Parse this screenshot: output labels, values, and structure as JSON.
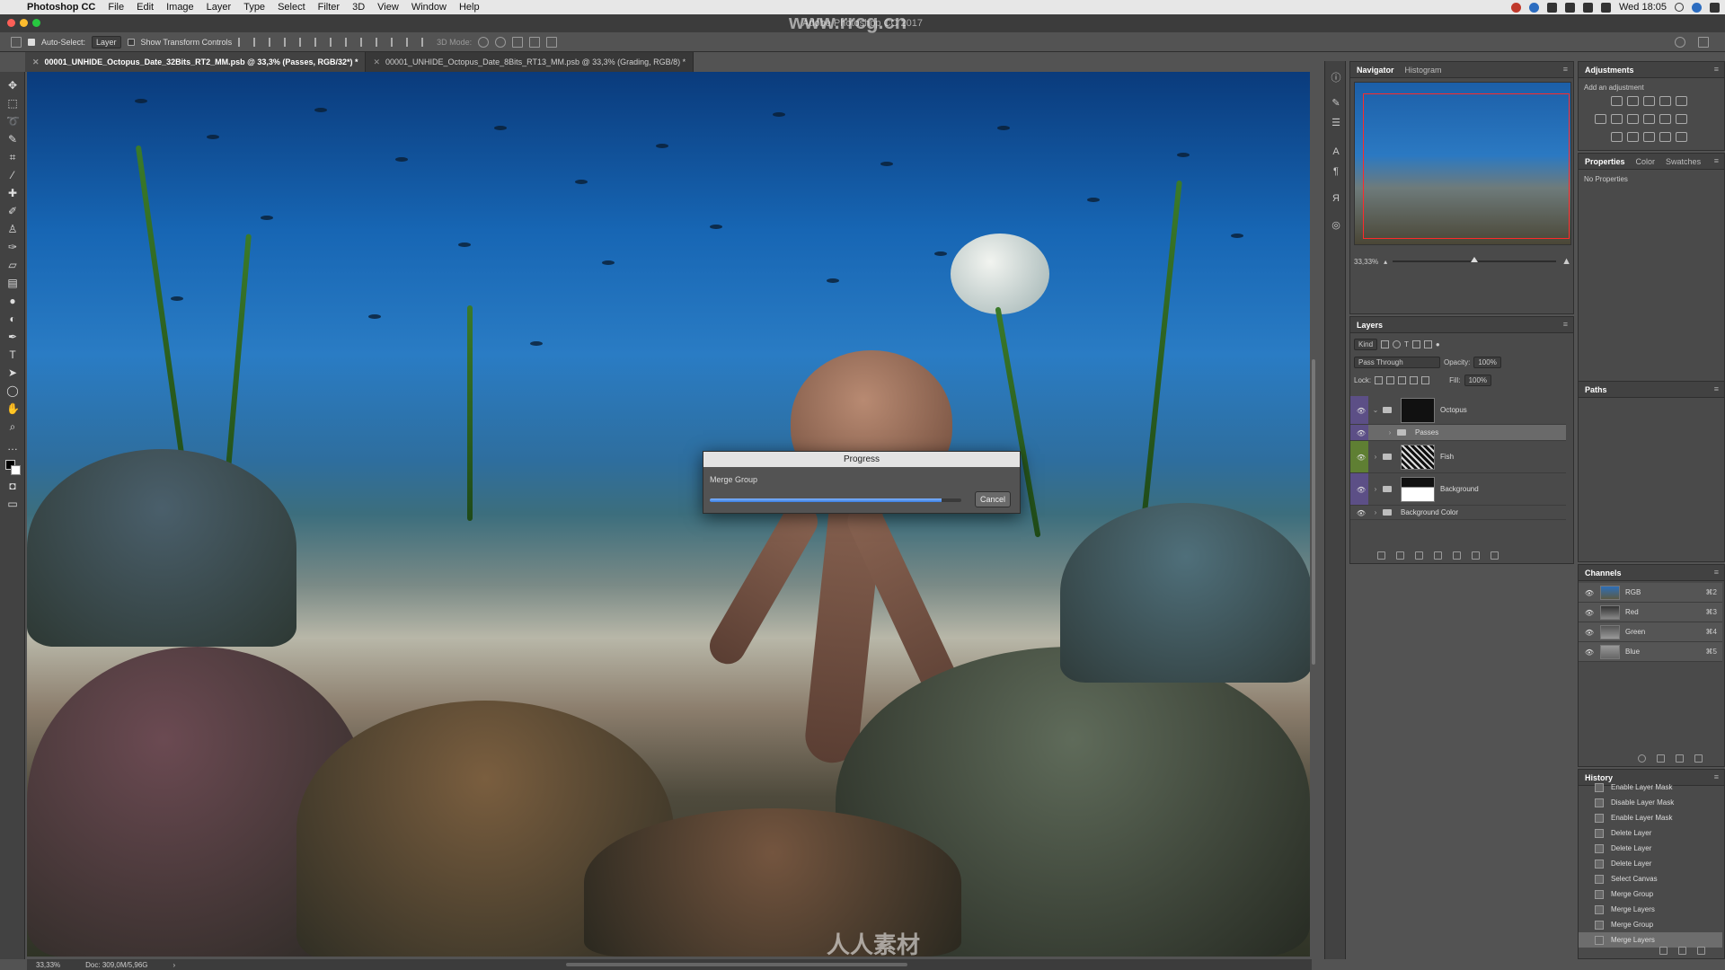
{
  "menubar": {
    "app": "Photoshop CC",
    "items": [
      "File",
      "Edit",
      "Image",
      "Layer",
      "Type",
      "Select",
      "Filter",
      "3D",
      "View",
      "Window",
      "Help"
    ],
    "clock": "Wed 18:05"
  },
  "window": {
    "title": "Adobe Photoshop CC 2017"
  },
  "options": {
    "auto_select_label": "Auto-Select:",
    "auto_select_value": "Layer",
    "transform_label": "Show Transform Controls",
    "mode_3d": "3D Mode:"
  },
  "tabs": [
    {
      "label": "00001_UNHIDE_Octopus_Date_32Bits_RT2_MM.psb @ 33,3% (Passes, RGB/32*) *"
    },
    {
      "label": "00001_UNHIDE_Octopus_Date_8Bits_RT13_MM.psb @ 33,3% (Grading, RGB/8) *"
    }
  ],
  "progress": {
    "title": "Progress",
    "label": "Merge Group",
    "value": 0.92,
    "cancel": "Cancel"
  },
  "statusbar": {
    "zoom": "33,33%",
    "doc": "Doc: 309,0M/5,96G"
  },
  "navigator": {
    "tabs": [
      "Navigator",
      "Histogram"
    ],
    "zoom": "33,33%"
  },
  "layers": {
    "title": "Layers",
    "kind": "Kind",
    "blend": "Pass Through",
    "opacity_label": "Opacity:",
    "opacity": "100%",
    "lock_label": "Lock:",
    "fill_label": "Fill:",
    "fill": "100%",
    "rows": [
      {
        "name": "Octopus",
        "tag": "#6a5a9a"
      },
      {
        "name": "Passes",
        "tag": "#6a5a9a"
      },
      {
        "name": "Fish",
        "tag": "#6a8a3a"
      },
      {
        "name": "Background",
        "tag": "#6a5a9a"
      },
      {
        "name": "Background Color",
        "tag": ""
      }
    ]
  },
  "adjustments": {
    "tabs": [
      "Adjustments"
    ],
    "subtitle": "Add an adjustment"
  },
  "properties": {
    "tabs": [
      "Properties",
      "Color",
      "Swatches"
    ],
    "message": "No Properties"
  },
  "paths": {
    "title": "Paths"
  },
  "channels": {
    "title": "Channels",
    "rows": [
      {
        "name": "RGB",
        "shortcut": "⌘2"
      },
      {
        "name": "Red",
        "shortcut": "⌘3"
      },
      {
        "name": "Green",
        "shortcut": "⌘4"
      },
      {
        "name": "Blue",
        "shortcut": "⌘5"
      }
    ]
  },
  "history": {
    "title": "History",
    "rows": [
      "Enable Layer Mask",
      "Disable Layer Mask",
      "Enable Layer Mask",
      "Delete Layer",
      "Delete Layer",
      "Delete Layer",
      "Select Canvas",
      "Merge Group",
      "Merge Layers",
      "Merge Group",
      "Merge Layers"
    ]
  },
  "watermarks": {
    "top": "www.rrcg.cn",
    "bottom": "人人素材"
  }
}
